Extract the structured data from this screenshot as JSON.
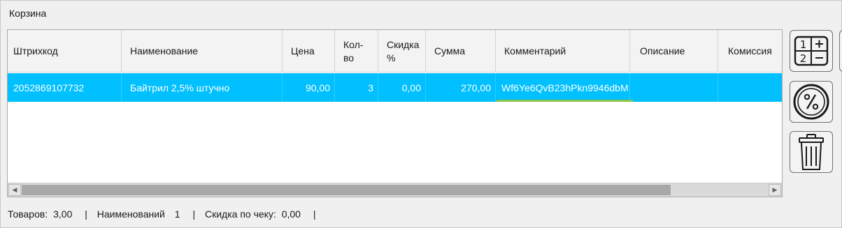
{
  "panel": {
    "title": "Корзина"
  },
  "columns": [
    "Штрихкод",
    "Наименование",
    "Цена",
    "Кол-\nво",
    "Скидка\n%",
    "Сумма",
    "Комментарий",
    "Описание",
    "Комиссия"
  ],
  "rows": [
    {
      "barcode": "2052869107732",
      "name": "Байтрил 2,5% штучно",
      "price": "90,00",
      "qty": "3",
      "discount": "0,00",
      "sum": "270,00",
      "comment": "Wf6Ye6QvB23hPkn9946dbM",
      "description": "",
      "commission": ""
    }
  ],
  "status": {
    "items_label": "Товаров:",
    "items_value": "3,00",
    "names_label": "Наименований",
    "names_value": "1",
    "discount_label": "Скидка по чеку:",
    "discount_value": "0,00",
    "separator": "|"
  },
  "buttons": {
    "calculator_icon": "calculator-icon",
    "discount_icon": "percent-icon",
    "delete_icon": "trash-icon"
  },
  "colors": {
    "selected_row": "#00c0ff",
    "underline": "#8bc34a"
  }
}
